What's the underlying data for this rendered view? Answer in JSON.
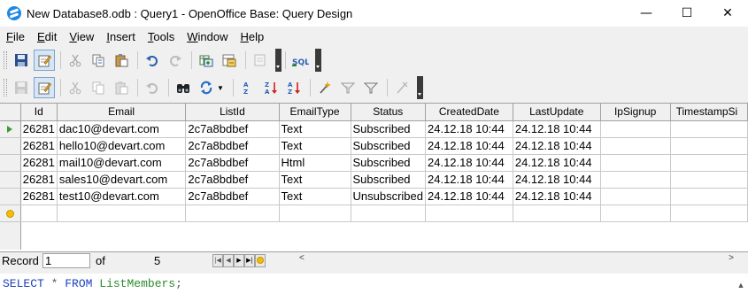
{
  "window": {
    "title": "New Database8.odb : Query1 - OpenOffice Base: Query Design",
    "minimize": "—",
    "maximize": "☐",
    "close": "✕"
  },
  "menu": [
    {
      "underline": "F",
      "rest": "ile"
    },
    {
      "underline": "E",
      "rest": "dit"
    },
    {
      "underline": "V",
      "rest": "iew"
    },
    {
      "underline": "I",
      "rest": "nsert"
    },
    {
      "underline": "T",
      "rest": "ools"
    },
    {
      "underline": "W",
      "rest": "indow"
    },
    {
      "underline": "H",
      "rest": "elp"
    }
  ],
  "toolbar1": {
    "icons": [
      "save-icon",
      "edit-icon",
      "cut-icon",
      "copy-icon",
      "paste-icon",
      "undo-icon",
      "redo-icon",
      "add-tables-icon",
      "functions-icon",
      "clear-icon",
      "sql-icon"
    ],
    "sql_label": "SQL"
  },
  "toolbar2": {
    "icons": [
      "save-record-icon",
      "edit-data-icon",
      "cut-icon",
      "copy-icon",
      "paste-icon",
      "undo-icon",
      "find-icon",
      "refresh-icon",
      "sort-asc-icon",
      "sort-desc-icon",
      "sort-icon",
      "autofilter-icon",
      "standard-filter-icon",
      "apply-filter-icon",
      "remove-filter-icon"
    ]
  },
  "grid": {
    "columns": [
      "Id",
      "Email",
      "ListId",
      "EmailType",
      "Status",
      "CreatedDate",
      "LastUpdate",
      "IpSignup",
      "TimestampSi"
    ],
    "rows": [
      [
        "26281",
        "dac10@devart.com",
        "2c7a8bdbef",
        "Text",
        "Subscribed",
        "24.12.18 10:44",
        "24.12.18 10:44",
        "",
        ""
      ],
      [
        "26281",
        "hello10@devart.com",
        "2c7a8bdbef",
        "Text",
        "Subscribed",
        "24.12.18 10:44",
        "24.12.18 10:44",
        "",
        ""
      ],
      [
        "26281",
        "mail10@devart.com",
        "2c7a8bdbef",
        "Html",
        "Subscribed",
        "24.12.18 10:44",
        "24.12.18 10:44",
        "",
        ""
      ],
      [
        "26281",
        "sales10@devart.com",
        "2c7a8bdbef",
        "Text",
        "Subscribed",
        "24.12.18 10:44",
        "24.12.18 10:44",
        "",
        ""
      ],
      [
        "26281",
        "test10@devart.com",
        "2c7a8bdbef",
        "Text",
        "Unsubscribed",
        "24.12.18 10:44",
        "24.12.18 10:44",
        "",
        ""
      ]
    ]
  },
  "navigation": {
    "record_label": "Record",
    "record_value": "1",
    "of_label": "of",
    "total": "5"
  },
  "sql": {
    "select": "SELECT",
    "star": "*",
    "from": "FROM",
    "table": "ListMembers",
    "end": ";"
  }
}
